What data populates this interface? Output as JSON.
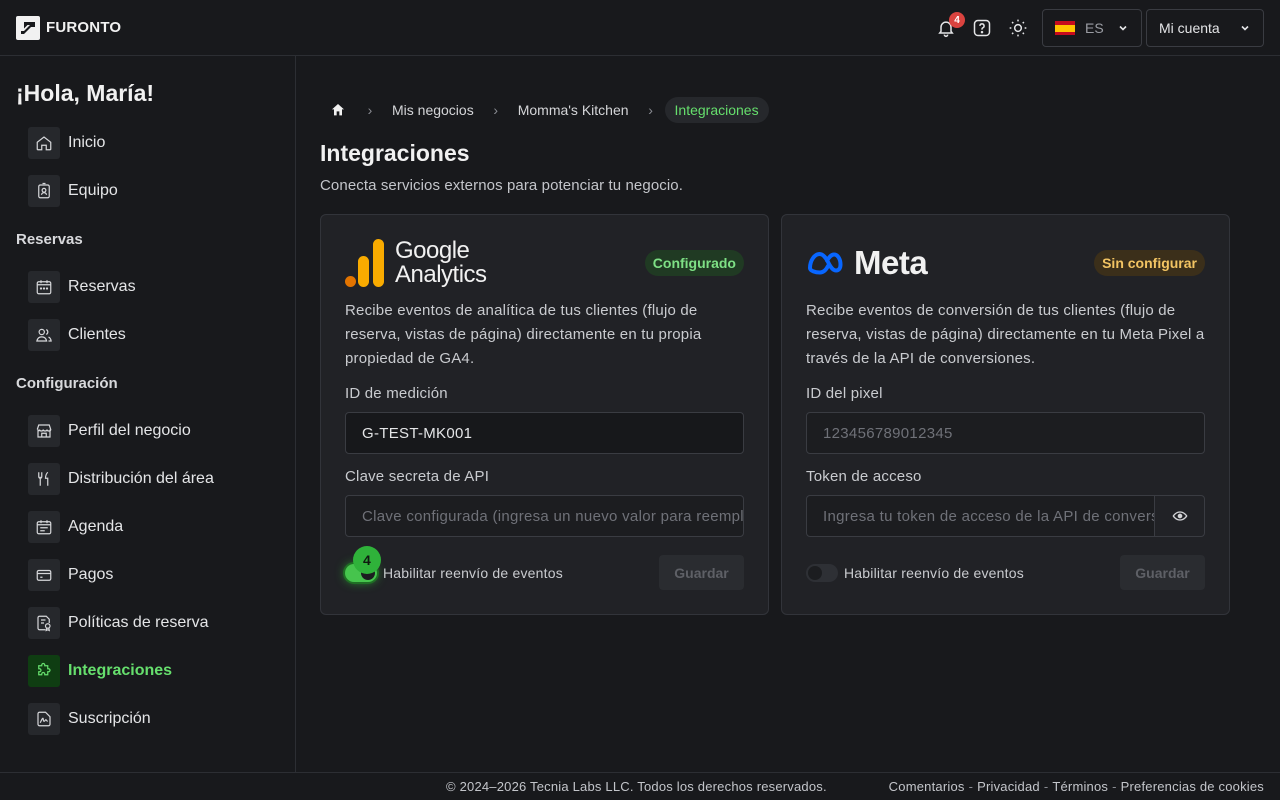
{
  "brand": {
    "name": "FURONTO"
  },
  "topbar": {
    "notification_count": "4",
    "language_code": "ES",
    "account_label": "Mi cuenta"
  },
  "sidebar": {
    "greeting": "¡Hola, María!",
    "items_top": [
      {
        "label": "Inicio",
        "icon": "home-icon"
      },
      {
        "label": "Equipo",
        "icon": "badge-icon"
      }
    ],
    "section_reservas": "Reservas",
    "items_reservas": [
      {
        "label": "Reservas",
        "icon": "calendar-icon"
      },
      {
        "label": "Clientes",
        "icon": "users-icon"
      }
    ],
    "section_config": "Configuración",
    "items_config": [
      {
        "label": "Perfil del negocio",
        "icon": "storefront-icon"
      },
      {
        "label": "Distribución del área",
        "icon": "utensils-icon"
      },
      {
        "label": "Agenda",
        "icon": "schedule-icon"
      },
      {
        "label": "Pagos",
        "icon": "credit-card-icon"
      },
      {
        "label": "Políticas de reserva",
        "icon": "policy-icon"
      },
      {
        "label": "Integraciones",
        "icon": "puzzle-icon",
        "active": true
      },
      {
        "label": "Suscripción",
        "icon": "signature-icon"
      }
    ]
  },
  "breadcrumb": {
    "items": [
      "Mis negocios",
      "Momma's Kitchen"
    ],
    "current": "Integraciones"
  },
  "page": {
    "title": "Integraciones",
    "subtitle": "Conecta servicios externos para potenciar tu negocio."
  },
  "cards": {
    "ga": {
      "logo_line1": "Google",
      "logo_line2": "Analytics",
      "status": "Configurado",
      "description": "Recibe eventos de analítica de tus clientes (flujo de reserva, vistas de página) directamente en tu propia propiedad de GA4.",
      "field1_label": "ID de medición",
      "field1_value": "G-TEST-MK001",
      "field2_label": "Clave secreta de API",
      "field2_placeholder": "Clave configurada (ingresa un nuevo valor para reemplazarla)",
      "toggle_label": "Habilitar reenvío de eventos",
      "toggle_on": true,
      "save_label": "Guardar",
      "marker": "4"
    },
    "meta": {
      "logo_text": "Meta",
      "status": "Sin configurar",
      "description": "Recibe eventos de conversión de tus clientes (flujo de reserva, vistas de página) directamente en tu Meta Pixel a través de la API de conversiones.",
      "field1_label": "ID del pixel",
      "field1_placeholder": "123456789012345",
      "field2_label": "Token de acceso",
      "field2_placeholder": "Ingresa tu token de acceso de la API de conversiones",
      "toggle_label": "Habilitar reenvío de eventos",
      "toggle_on": false,
      "save_label": "Guardar"
    }
  },
  "footer": {
    "copyright": "© 2024–2026 Tecnia Labs LLC. Todos los derechos reservados.",
    "links": [
      "Comentarios",
      "Privacidad",
      "Términos",
      "Preferencias de cookies"
    ]
  },
  "colors": {
    "accent_green": "#66df6d",
    "warning": "#f2c463",
    "badge_red": "#d9433f",
    "ga_orange": "#f9ab00",
    "ga_dark_orange": "#e37400",
    "meta_blue": "#0866ff"
  }
}
